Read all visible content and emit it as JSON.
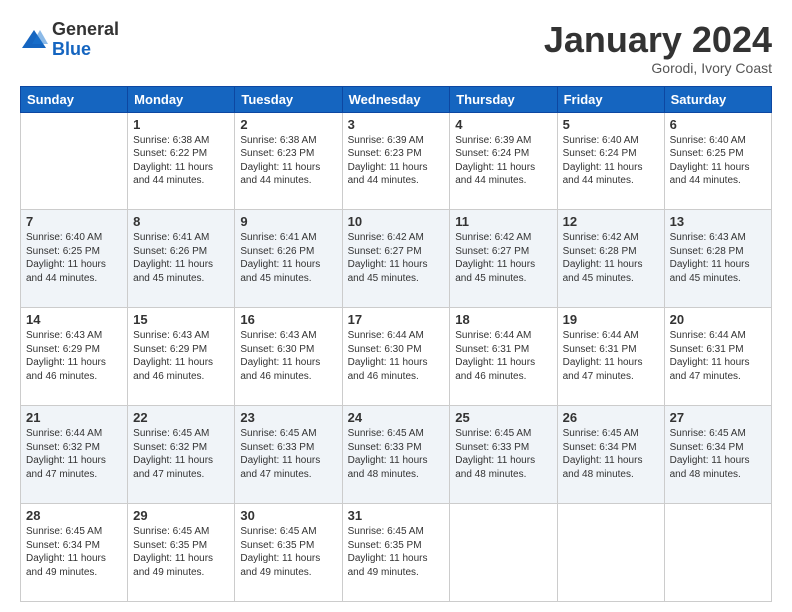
{
  "header": {
    "logo_general": "General",
    "logo_blue": "Blue",
    "month_title": "January 2024",
    "location": "Gorodi, Ivory Coast"
  },
  "days_of_week": [
    "Sunday",
    "Monday",
    "Tuesday",
    "Wednesday",
    "Thursday",
    "Friday",
    "Saturday"
  ],
  "weeks": [
    [
      {
        "day": "",
        "info": ""
      },
      {
        "day": "1",
        "sunrise": "Sunrise: 6:38 AM",
        "sunset": "Sunset: 6:22 PM",
        "daylight": "Daylight: 11 hours and 44 minutes."
      },
      {
        "day": "2",
        "sunrise": "Sunrise: 6:38 AM",
        "sunset": "Sunset: 6:23 PM",
        "daylight": "Daylight: 11 hours and 44 minutes."
      },
      {
        "day": "3",
        "sunrise": "Sunrise: 6:39 AM",
        "sunset": "Sunset: 6:23 PM",
        "daylight": "Daylight: 11 hours and 44 minutes."
      },
      {
        "day": "4",
        "sunrise": "Sunrise: 6:39 AM",
        "sunset": "Sunset: 6:24 PM",
        "daylight": "Daylight: 11 hours and 44 minutes."
      },
      {
        "day": "5",
        "sunrise": "Sunrise: 6:40 AM",
        "sunset": "Sunset: 6:24 PM",
        "daylight": "Daylight: 11 hours and 44 minutes."
      },
      {
        "day": "6",
        "sunrise": "Sunrise: 6:40 AM",
        "sunset": "Sunset: 6:25 PM",
        "daylight": "Daylight: 11 hours and 44 minutes."
      }
    ],
    [
      {
        "day": "7",
        "sunrise": "Sunrise: 6:40 AM",
        "sunset": "Sunset: 6:25 PM",
        "daylight": "Daylight: 11 hours and 44 minutes."
      },
      {
        "day": "8",
        "sunrise": "Sunrise: 6:41 AM",
        "sunset": "Sunset: 6:26 PM",
        "daylight": "Daylight: 11 hours and 45 minutes."
      },
      {
        "day": "9",
        "sunrise": "Sunrise: 6:41 AM",
        "sunset": "Sunset: 6:26 PM",
        "daylight": "Daylight: 11 hours and 45 minutes."
      },
      {
        "day": "10",
        "sunrise": "Sunrise: 6:42 AM",
        "sunset": "Sunset: 6:27 PM",
        "daylight": "Daylight: 11 hours and 45 minutes."
      },
      {
        "day": "11",
        "sunrise": "Sunrise: 6:42 AM",
        "sunset": "Sunset: 6:27 PM",
        "daylight": "Daylight: 11 hours and 45 minutes."
      },
      {
        "day": "12",
        "sunrise": "Sunrise: 6:42 AM",
        "sunset": "Sunset: 6:28 PM",
        "daylight": "Daylight: 11 hours and 45 minutes."
      },
      {
        "day": "13",
        "sunrise": "Sunrise: 6:43 AM",
        "sunset": "Sunset: 6:28 PM",
        "daylight": "Daylight: 11 hours and 45 minutes."
      }
    ],
    [
      {
        "day": "14",
        "sunrise": "Sunrise: 6:43 AM",
        "sunset": "Sunset: 6:29 PM",
        "daylight": "Daylight: 11 hours and 46 minutes."
      },
      {
        "day": "15",
        "sunrise": "Sunrise: 6:43 AM",
        "sunset": "Sunset: 6:29 PM",
        "daylight": "Daylight: 11 hours and 46 minutes."
      },
      {
        "day": "16",
        "sunrise": "Sunrise: 6:43 AM",
        "sunset": "Sunset: 6:30 PM",
        "daylight": "Daylight: 11 hours and 46 minutes."
      },
      {
        "day": "17",
        "sunrise": "Sunrise: 6:44 AM",
        "sunset": "Sunset: 6:30 PM",
        "daylight": "Daylight: 11 hours and 46 minutes."
      },
      {
        "day": "18",
        "sunrise": "Sunrise: 6:44 AM",
        "sunset": "Sunset: 6:31 PM",
        "daylight": "Daylight: 11 hours and 46 minutes."
      },
      {
        "day": "19",
        "sunrise": "Sunrise: 6:44 AM",
        "sunset": "Sunset: 6:31 PM",
        "daylight": "Daylight: 11 hours and 47 minutes."
      },
      {
        "day": "20",
        "sunrise": "Sunrise: 6:44 AM",
        "sunset": "Sunset: 6:31 PM",
        "daylight": "Daylight: 11 hours and 47 minutes."
      }
    ],
    [
      {
        "day": "21",
        "sunrise": "Sunrise: 6:44 AM",
        "sunset": "Sunset: 6:32 PM",
        "daylight": "Daylight: 11 hours and 47 minutes."
      },
      {
        "day": "22",
        "sunrise": "Sunrise: 6:45 AM",
        "sunset": "Sunset: 6:32 PM",
        "daylight": "Daylight: 11 hours and 47 minutes."
      },
      {
        "day": "23",
        "sunrise": "Sunrise: 6:45 AM",
        "sunset": "Sunset: 6:33 PM",
        "daylight": "Daylight: 11 hours and 47 minutes."
      },
      {
        "day": "24",
        "sunrise": "Sunrise: 6:45 AM",
        "sunset": "Sunset: 6:33 PM",
        "daylight": "Daylight: 11 hours and 48 minutes."
      },
      {
        "day": "25",
        "sunrise": "Sunrise: 6:45 AM",
        "sunset": "Sunset: 6:33 PM",
        "daylight": "Daylight: 11 hours and 48 minutes."
      },
      {
        "day": "26",
        "sunrise": "Sunrise: 6:45 AM",
        "sunset": "Sunset: 6:34 PM",
        "daylight": "Daylight: 11 hours and 48 minutes."
      },
      {
        "day": "27",
        "sunrise": "Sunrise: 6:45 AM",
        "sunset": "Sunset: 6:34 PM",
        "daylight": "Daylight: 11 hours and 48 minutes."
      }
    ],
    [
      {
        "day": "28",
        "sunrise": "Sunrise: 6:45 AM",
        "sunset": "Sunset: 6:34 PM",
        "daylight": "Daylight: 11 hours and 49 minutes."
      },
      {
        "day": "29",
        "sunrise": "Sunrise: 6:45 AM",
        "sunset": "Sunset: 6:35 PM",
        "daylight": "Daylight: 11 hours and 49 minutes."
      },
      {
        "day": "30",
        "sunrise": "Sunrise: 6:45 AM",
        "sunset": "Sunset: 6:35 PM",
        "daylight": "Daylight: 11 hours and 49 minutes."
      },
      {
        "day": "31",
        "sunrise": "Sunrise: 6:45 AM",
        "sunset": "Sunset: 6:35 PM",
        "daylight": "Daylight: 11 hours and 49 minutes."
      },
      {
        "day": "",
        "info": ""
      },
      {
        "day": "",
        "info": ""
      },
      {
        "day": "",
        "info": ""
      }
    ]
  ]
}
